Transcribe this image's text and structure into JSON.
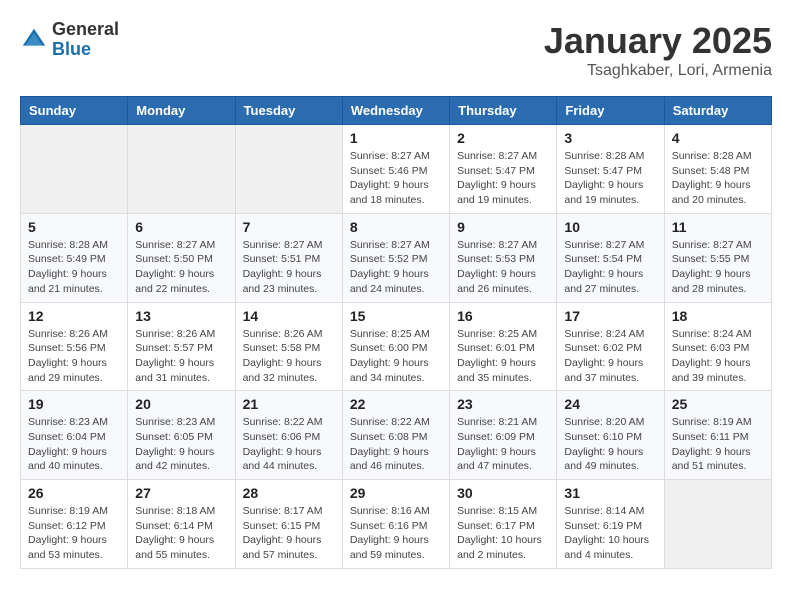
{
  "logo": {
    "general": "General",
    "blue": "Blue"
  },
  "header": {
    "month": "January 2025",
    "location": "Tsaghkaber, Lori, Armenia"
  },
  "weekdays": [
    "Sunday",
    "Monday",
    "Tuesday",
    "Wednesday",
    "Thursday",
    "Friday",
    "Saturday"
  ],
  "weeks": [
    [
      {
        "day": "",
        "info": ""
      },
      {
        "day": "",
        "info": ""
      },
      {
        "day": "",
        "info": ""
      },
      {
        "day": "1",
        "info": "Sunrise: 8:27 AM\nSunset: 5:46 PM\nDaylight: 9 hours\nand 18 minutes."
      },
      {
        "day": "2",
        "info": "Sunrise: 8:27 AM\nSunset: 5:47 PM\nDaylight: 9 hours\nand 19 minutes."
      },
      {
        "day": "3",
        "info": "Sunrise: 8:28 AM\nSunset: 5:47 PM\nDaylight: 9 hours\nand 19 minutes."
      },
      {
        "day": "4",
        "info": "Sunrise: 8:28 AM\nSunset: 5:48 PM\nDaylight: 9 hours\nand 20 minutes."
      }
    ],
    [
      {
        "day": "5",
        "info": "Sunrise: 8:28 AM\nSunset: 5:49 PM\nDaylight: 9 hours\nand 21 minutes."
      },
      {
        "day": "6",
        "info": "Sunrise: 8:27 AM\nSunset: 5:50 PM\nDaylight: 9 hours\nand 22 minutes."
      },
      {
        "day": "7",
        "info": "Sunrise: 8:27 AM\nSunset: 5:51 PM\nDaylight: 9 hours\nand 23 minutes."
      },
      {
        "day": "8",
        "info": "Sunrise: 8:27 AM\nSunset: 5:52 PM\nDaylight: 9 hours\nand 24 minutes."
      },
      {
        "day": "9",
        "info": "Sunrise: 8:27 AM\nSunset: 5:53 PM\nDaylight: 9 hours\nand 26 minutes."
      },
      {
        "day": "10",
        "info": "Sunrise: 8:27 AM\nSunset: 5:54 PM\nDaylight: 9 hours\nand 27 minutes."
      },
      {
        "day": "11",
        "info": "Sunrise: 8:27 AM\nSunset: 5:55 PM\nDaylight: 9 hours\nand 28 minutes."
      }
    ],
    [
      {
        "day": "12",
        "info": "Sunrise: 8:26 AM\nSunset: 5:56 PM\nDaylight: 9 hours\nand 29 minutes."
      },
      {
        "day": "13",
        "info": "Sunrise: 8:26 AM\nSunset: 5:57 PM\nDaylight: 9 hours\nand 31 minutes."
      },
      {
        "day": "14",
        "info": "Sunrise: 8:26 AM\nSunset: 5:58 PM\nDaylight: 9 hours\nand 32 minutes."
      },
      {
        "day": "15",
        "info": "Sunrise: 8:25 AM\nSunset: 6:00 PM\nDaylight: 9 hours\nand 34 minutes."
      },
      {
        "day": "16",
        "info": "Sunrise: 8:25 AM\nSunset: 6:01 PM\nDaylight: 9 hours\nand 35 minutes."
      },
      {
        "day": "17",
        "info": "Sunrise: 8:24 AM\nSunset: 6:02 PM\nDaylight: 9 hours\nand 37 minutes."
      },
      {
        "day": "18",
        "info": "Sunrise: 8:24 AM\nSunset: 6:03 PM\nDaylight: 9 hours\nand 39 minutes."
      }
    ],
    [
      {
        "day": "19",
        "info": "Sunrise: 8:23 AM\nSunset: 6:04 PM\nDaylight: 9 hours\nand 40 minutes."
      },
      {
        "day": "20",
        "info": "Sunrise: 8:23 AM\nSunset: 6:05 PM\nDaylight: 9 hours\nand 42 minutes."
      },
      {
        "day": "21",
        "info": "Sunrise: 8:22 AM\nSunset: 6:06 PM\nDaylight: 9 hours\nand 44 minutes."
      },
      {
        "day": "22",
        "info": "Sunrise: 8:22 AM\nSunset: 6:08 PM\nDaylight: 9 hours\nand 46 minutes."
      },
      {
        "day": "23",
        "info": "Sunrise: 8:21 AM\nSunset: 6:09 PM\nDaylight: 9 hours\nand 47 minutes."
      },
      {
        "day": "24",
        "info": "Sunrise: 8:20 AM\nSunset: 6:10 PM\nDaylight: 9 hours\nand 49 minutes."
      },
      {
        "day": "25",
        "info": "Sunrise: 8:19 AM\nSunset: 6:11 PM\nDaylight: 9 hours\nand 51 minutes."
      }
    ],
    [
      {
        "day": "26",
        "info": "Sunrise: 8:19 AM\nSunset: 6:12 PM\nDaylight: 9 hours\nand 53 minutes."
      },
      {
        "day": "27",
        "info": "Sunrise: 8:18 AM\nSunset: 6:14 PM\nDaylight: 9 hours\nand 55 minutes."
      },
      {
        "day": "28",
        "info": "Sunrise: 8:17 AM\nSunset: 6:15 PM\nDaylight: 9 hours\nand 57 minutes."
      },
      {
        "day": "29",
        "info": "Sunrise: 8:16 AM\nSunset: 6:16 PM\nDaylight: 9 hours\nand 59 minutes."
      },
      {
        "day": "30",
        "info": "Sunrise: 8:15 AM\nSunset: 6:17 PM\nDaylight: 10 hours\nand 2 minutes."
      },
      {
        "day": "31",
        "info": "Sunrise: 8:14 AM\nSunset: 6:19 PM\nDaylight: 10 hours\nand 4 minutes."
      },
      {
        "day": "",
        "info": ""
      }
    ]
  ]
}
